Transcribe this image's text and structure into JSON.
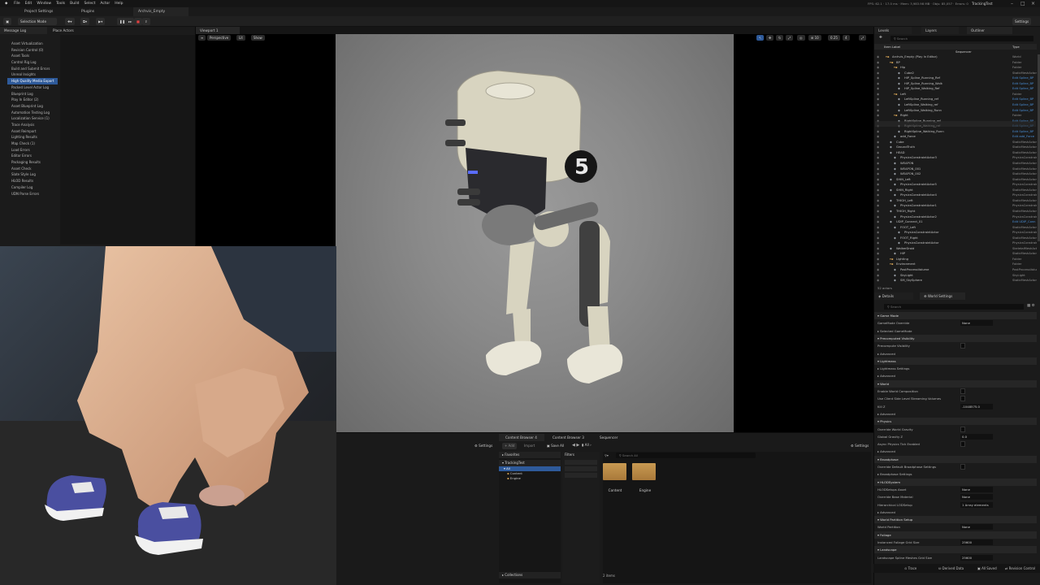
{
  "menu": [
    "File",
    "Edit",
    "Window",
    "Tools",
    "Build",
    "Select",
    "Actor",
    "Help"
  ],
  "stats": "FPS: 62.1 · 17.0 ms · Mem: 3,983.98 MB · Objs: 85,057 · Errors: 0",
  "project_name": "TrackingTest",
  "doc_tabs": [
    "Project Settings",
    "Plugins",
    "Archvis_Empty"
  ],
  "toolbar": {
    "mode": "Selection Mode",
    "settings": "Settings"
  },
  "left_tabs": [
    "Message Log",
    "Place Actors"
  ],
  "log_categories": [
    "Asset Virtualization",
    "Revision Control (0)",
    "Asset Tools",
    "Control Rig Log",
    "Build and Submit Errors",
    "Unreal Insights",
    "High Quality Media Export",
    "Packed Level Actor Log",
    "Blueprint Log",
    "Play In Editor (2)",
    "Asset Blueprint Log",
    "Automation Testing Log",
    "Localization Service (1)",
    "Trace Analysis",
    "Asset Reimport",
    "Lighting Results",
    "Map Check (1)",
    "Load Errors",
    "Editor Errors",
    "Packaging Results",
    "Asset Check",
    "Slate Style Log",
    "HLOD Results",
    "Compiler Log",
    "UDN Parse Errors"
  ],
  "log_selected_index": 6,
  "viewport": {
    "tab": "Viewport 1",
    "view": "Perspective",
    "lit": "Lit",
    "show": "Show",
    "num1": "0.25",
    "num2": "4",
    "num3": "10"
  },
  "content": {
    "tabs": [
      "Content Browser 4",
      "Content Browser 3",
      "Sequencer"
    ],
    "settings": "Settings",
    "add": "+ Add",
    "import": "Import",
    "save_all": "Save All",
    "all": "All",
    "favorites": "Favorites",
    "project": "TrackingTest",
    "tree": [
      "All",
      "Content",
      "Engine"
    ],
    "filters": "Filters",
    "search": "Search All",
    "folders": [
      "Content",
      "Engine"
    ],
    "collections": "Collections",
    "count": "2 items"
  },
  "outliner": {
    "tabs": [
      "Levels",
      "Layers",
      "Outliner"
    ],
    "search": "Search",
    "col_item": "Item Label",
    "col_type": "Type",
    "sequencer": "Sequencer",
    "rows": [
      {
        "name": "Archvis_Empty (Play In Editor)",
        "type": "World",
        "d": 0
      },
      {
        "name": "BP",
        "type": "Folder",
        "d": 1
      },
      {
        "name": "Hip",
        "type": "Folder",
        "d": 2
      },
      {
        "name": "Cube2",
        "type": "StaticMeshActor",
        "d": 3
      },
      {
        "name": "HIP_Spline_Running_Ref",
        "type": "Edit Spline_BP",
        "d": 3,
        "link": true
      },
      {
        "name": "HIP_Spline_Running_Walk",
        "type": "Edit Spline_BP",
        "d": 3,
        "link": true
      },
      {
        "name": "HIP_Spline_Walking_Ref",
        "type": "Edit Spline_BP",
        "d": 3,
        "link": true
      },
      {
        "name": "Left",
        "type": "Folder",
        "d": 2
      },
      {
        "name": "LeftSpline_Running_ref",
        "type": "Edit Spline_BP",
        "d": 3,
        "link": true
      },
      {
        "name": "LeftSpline_Walking_ref",
        "type": "Edit Spline_BP",
        "d": 3,
        "link": true
      },
      {
        "name": "LeftSpline_Walking_Runn",
        "type": "Edit Spline_BP",
        "d": 3,
        "link": true
      },
      {
        "name": "Right",
        "type": "Folder",
        "d": 2
      },
      {
        "name": "RightSpline_Running_ref",
        "type": "Edit Spline_BP",
        "d": 3,
        "link": true
      },
      {
        "name": "RightSpline_Walking_ref",
        "type": "Edit Spline_BP",
        "d": 3,
        "link": true
      },
      {
        "name": "RightSpline_Walking_Runn",
        "type": "Edit Spline_BP",
        "d": 3,
        "link": true
      },
      {
        "name": "add_Force",
        "type": "Edit add_Force",
        "d": 2,
        "link": true
      },
      {
        "name": "Cube",
        "type": "StaticMeshActor",
        "d": 1
      },
      {
        "name": "GroundTruth",
        "type": "StaticMeshActor",
        "d": 1
      },
      {
        "name": "HEAD",
        "type": "StaticMeshActor",
        "d": 1
      },
      {
        "name": "PhysicsConstraintActor3",
        "type": "PhysicsConstraint",
        "d": 2
      },
      {
        "name": "WEAPON",
        "type": "StaticMeshActor",
        "d": 2
      },
      {
        "name": "WEAPON_001",
        "type": "StaticMeshActor",
        "d": 2
      },
      {
        "name": "WEAPON_002",
        "type": "StaticMeshActor",
        "d": 2
      },
      {
        "name": "SHIN_Left",
        "type": "StaticMeshActor",
        "d": 1
      },
      {
        "name": "PhysicsConstraintActor5",
        "type": "PhysicsConstraint",
        "d": 2
      },
      {
        "name": "SHIN_Right",
        "type": "StaticMeshActor",
        "d": 1
      },
      {
        "name": "PhysicsConstraintActor4",
        "type": "PhysicsConstraint",
        "d": 2
      },
      {
        "name": "THIGH_Left",
        "type": "StaticMeshActor",
        "d": 1
      },
      {
        "name": "PhysicsConstraintActor1",
        "type": "PhysicsConstraint",
        "d": 2
      },
      {
        "name": "THIGH_Right",
        "type": "StaticMeshActor",
        "d": 1
      },
      {
        "name": "PhysicsConstraintActor2",
        "type": "PhysicsConstraint",
        "d": 2
      },
      {
        "name": "UDIP_Connect_01",
        "type": "Edit UDIP_Conn",
        "d": 1,
        "link": true
      },
      {
        "name": "FOOT_Left",
        "type": "StaticMeshActor",
        "d": 2
      },
      {
        "name": "PhysicsConstraintActor",
        "type": "PhysicsConstraint",
        "d": 3
      },
      {
        "name": "FOOT_Right",
        "type": "StaticMeshActor",
        "d": 2
      },
      {
        "name": "PhysicsConstraintActor",
        "type": "PhysicsConstraint",
        "d": 3
      },
      {
        "name": "WalkerDroid",
        "type": "SkeletalMeshActor",
        "d": 1
      },
      {
        "name": "HIP",
        "type": "StaticMeshActor",
        "d": 2
      },
      {
        "name": "Lighting",
        "type": "Folder",
        "d": 1
      },
      {
        "name": "Environment",
        "type": "Folder",
        "d": 1
      },
      {
        "name": "PostProcessVolume",
        "type": "PostProcessVolume",
        "d": 2
      },
      {
        "name": "SkyLight",
        "type": "SkyLight",
        "d": 2
      },
      {
        "name": "SM_SkySphere",
        "type": "StaticMeshActor",
        "d": 2
      }
    ],
    "count": "52 actors"
  },
  "details": {
    "tabs": [
      "Details",
      "World Settings"
    ],
    "search": "Search",
    "rows": [
      {
        "label": "Game Mode",
        "section": true
      },
      {
        "label": "GameMode Override",
        "val": "None"
      },
      {
        "label": "Selected GameMode",
        "section": false
      },
      {
        "label": "Precomputed Visibility",
        "section": true
      },
      {
        "label": "Precompute Visibility",
        "val": ""
      },
      {
        "label": "Advanced",
        "section": false
      },
      {
        "label": "Lightmass",
        "section": true
      },
      {
        "label": "Lightmass Settings",
        "section": false
      },
      {
        "label": "Advanced",
        "section": false
      },
      {
        "label": "World",
        "section": true
      },
      {
        "label": "Enable World Composition",
        "val": ""
      },
      {
        "label": "Use Client Side Level Streaming Volumes",
        "val": ""
      },
      {
        "label": "Kill Z",
        "val": "-1048575.0"
      },
      {
        "label": "Advanced",
        "section": false
      },
      {
        "label": "Physics",
        "section": true
      },
      {
        "label": "Override World Gravity",
        "val": ""
      },
      {
        "label": "Global Gravity Z",
        "val": "0.0"
      },
      {
        "label": "Async Physics Tick Enabled",
        "val": ""
      },
      {
        "label": "Advanced",
        "section": false
      },
      {
        "label": "Broadphase",
        "section": true
      },
      {
        "label": "Override Default Broadphase Settings",
        "val": ""
      },
      {
        "label": "Broadphase Settings",
        "section": false
      },
      {
        "label": "HLODSystem",
        "section": true
      },
      {
        "label": "HLODSetups Asset",
        "val": "None"
      },
      {
        "label": "Override Base Material",
        "val": "None"
      },
      {
        "label": "Hierarchical LODSetup",
        "val": "1 Array elements"
      },
      {
        "label": "Advanced",
        "section": false
      },
      {
        "label": "World Partition Setup",
        "section": true
      },
      {
        "label": "World Partition",
        "val": "None"
      },
      {
        "label": "Foliage",
        "section": true
      },
      {
        "label": "Instanced Foliage Grid Size",
        "val": "25600"
      },
      {
        "label": "Landscape",
        "section": true
      },
      {
        "label": "Landscape Spline Meshes Grid Size",
        "val": "25600"
      }
    ]
  },
  "status": {
    "trace": "Trace",
    "derived": "Derived Data",
    "saved": "All Saved",
    "revision": "Revision Control"
  },
  "colors": {
    "accent": "#2e5a9a",
    "link": "#4a8fd6",
    "folder": "#c89a52",
    "robot_body": "#d8d4c0",
    "robot_dark": "#2a2a2e"
  }
}
